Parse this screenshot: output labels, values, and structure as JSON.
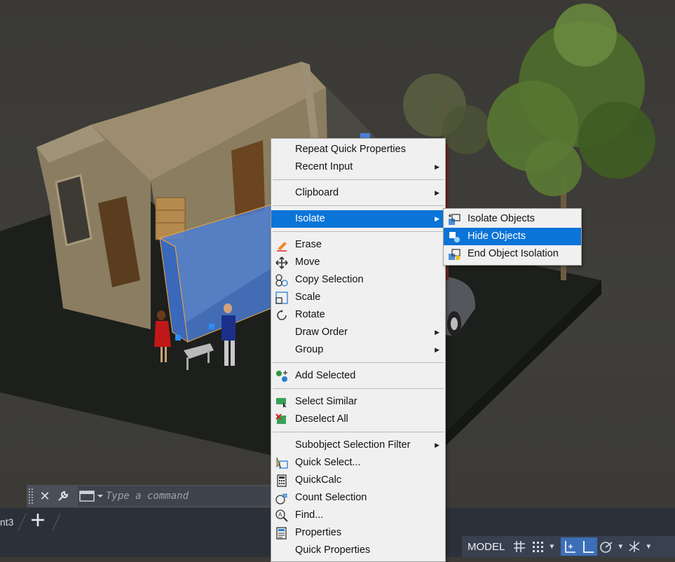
{
  "command_line": {
    "placeholder": "Type a command"
  },
  "layout_tabs": {
    "current_tab": "nt3"
  },
  "status_bar": {
    "model_label": "MODEL"
  },
  "context_menu": {
    "items": {
      "repeat_quick_properties": "Repeat Quick Properties",
      "recent_input": "Recent Input",
      "clipboard": "Clipboard",
      "isolate": "Isolate",
      "erase": "Erase",
      "move": "Move",
      "copy_selection": "Copy Selection",
      "scale": "Scale",
      "rotate": "Rotate",
      "draw_order": "Draw Order",
      "group": "Group",
      "add_selected": "Add Selected",
      "select_similar": "Select Similar",
      "deselect_all": "Deselect All",
      "subobject_selection_filter": "Subobject Selection Filter",
      "quick_select": "Quick Select...",
      "quickcalc": "QuickCalc",
      "count_selection": "Count Selection",
      "find": "Find...",
      "properties": "Properties",
      "quick_properties": "Quick Properties"
    },
    "highlighted_item": "Isolate"
  },
  "isolate_submenu": {
    "items": {
      "isolate_objects": "Isolate Objects",
      "hide_objects": "Hide Objects",
      "end_object_isolation": "End Object Isolation"
    },
    "highlighted_item": "Hide Objects"
  },
  "colors": {
    "menu_highlight": "#0a74d8",
    "selection_blue": "#4a7fd8",
    "status_active": "#3c6fb8",
    "viewport_bg": "#3b3a36"
  }
}
